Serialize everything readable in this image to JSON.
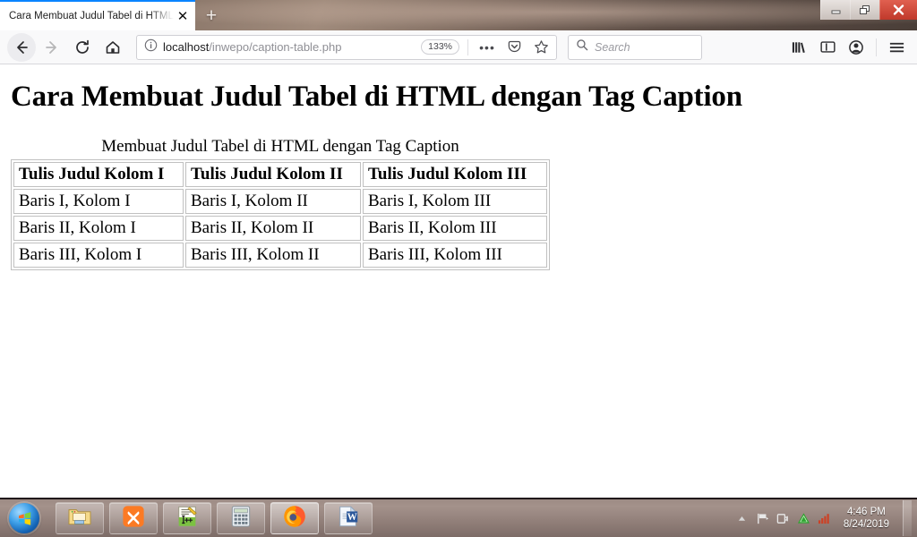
{
  "window": {
    "controls": {
      "minimize": "minimize",
      "restore": "restore",
      "close": "close"
    }
  },
  "tabs": {
    "items": [
      {
        "title": "Cara Membuat Judul Tabel di HTML",
        "close_label": "✕",
        "active": true
      }
    ],
    "new_tab_label": "+"
  },
  "toolbar": {
    "back_label": "Back",
    "forward_label": "Forward",
    "reload_label": "Reload",
    "home_label": "Home",
    "url_host": "localhost",
    "url_path": "/inwepo/caption-table.php",
    "zoom_level": "133%",
    "page_actions_label": "•••",
    "pocket_label": "Save to Pocket",
    "bookmark_label": "Bookmark this page",
    "library_label": "Library",
    "sidebar_label": "Sidebars",
    "account_label": "Account",
    "menu_label": "Open menu"
  },
  "search": {
    "placeholder": "Search",
    "value": ""
  },
  "page": {
    "heading": "Cara Membuat Judul Tabel di HTML dengan Tag Caption",
    "table": {
      "caption": "Membuat Judul Tabel di HTML dengan Tag Caption",
      "headers": [
        "Tulis Judul Kolom I",
        "Tulis Judul Kolom II",
        "Tulis Judul Kolom III"
      ],
      "rows": [
        [
          "Baris I, Kolom I",
          "Baris I, Kolom II",
          "Baris I, Kolom III"
        ],
        [
          "Baris II, Kolom I",
          "Baris II, Kolom II",
          "Baris II, Kolom III"
        ],
        [
          "Baris III, Kolom I",
          "Baris III, Kolom II",
          "Baris III, Kolom III"
        ]
      ]
    }
  },
  "taskbar": {
    "start_label": "Start",
    "items": [
      {
        "name": "file-explorer",
        "label": "Windows Explorer"
      },
      {
        "name": "xampp",
        "label": "XAMPP Control Panel"
      },
      {
        "name": "notepad-plus-plus",
        "label": "Notepad++"
      },
      {
        "name": "calculator",
        "label": "Calculator"
      },
      {
        "name": "firefox",
        "label": "Mozilla Firefox",
        "active": true
      },
      {
        "name": "word",
        "label": "Microsoft Word"
      }
    ],
    "tray": [
      {
        "name": "show-hidden-icons",
        "label": "Show hidden icons"
      },
      {
        "name": "action-center-flag",
        "label": "Action Center"
      },
      {
        "name": "power-plug",
        "label": "Power"
      },
      {
        "name": "green-triangle",
        "label": "Notification"
      },
      {
        "name": "network-signal",
        "label": "Network"
      }
    ],
    "clock_time": "4:46 PM",
    "clock_date": "8/24/2019"
  },
  "colors": {
    "tab_accent": "#0a84ff",
    "close_button": "#c0392b",
    "taskbar": "#9c8a84"
  }
}
